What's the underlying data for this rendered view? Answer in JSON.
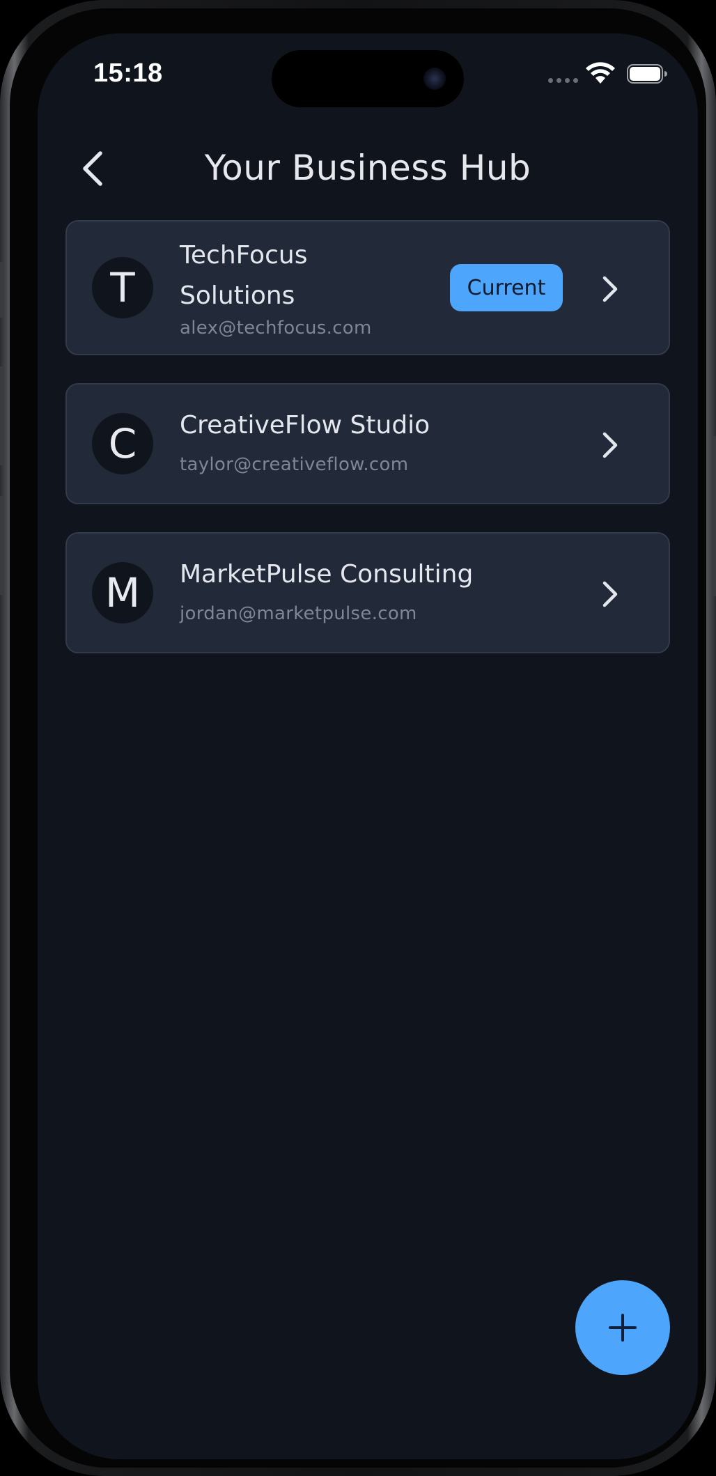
{
  "status_bar": {
    "time": "15:18"
  },
  "header": {
    "title": "Your Business Hub",
    "back_icon": "chevron-left-icon"
  },
  "businesses": [
    {
      "initial": "T",
      "name": "TechFocus Solutions",
      "email": "alex@techfocus.com",
      "badge": "Current"
    },
    {
      "initial": "C",
      "name": "CreativeFlow Studio",
      "email": "taylor@creativeflow.com"
    },
    {
      "initial": "M",
      "name": "MarketPulse Consulting",
      "email": "jordan@marketpulse.com"
    }
  ],
  "fab": {
    "icon": "plus-icon"
  },
  "colors": {
    "background": "#10141d",
    "card": "#222938",
    "card_border": "#333b4b",
    "accent": "#4da6fc",
    "text_primary": "#e4e7ee",
    "text_secondary": "#7f8796"
  }
}
